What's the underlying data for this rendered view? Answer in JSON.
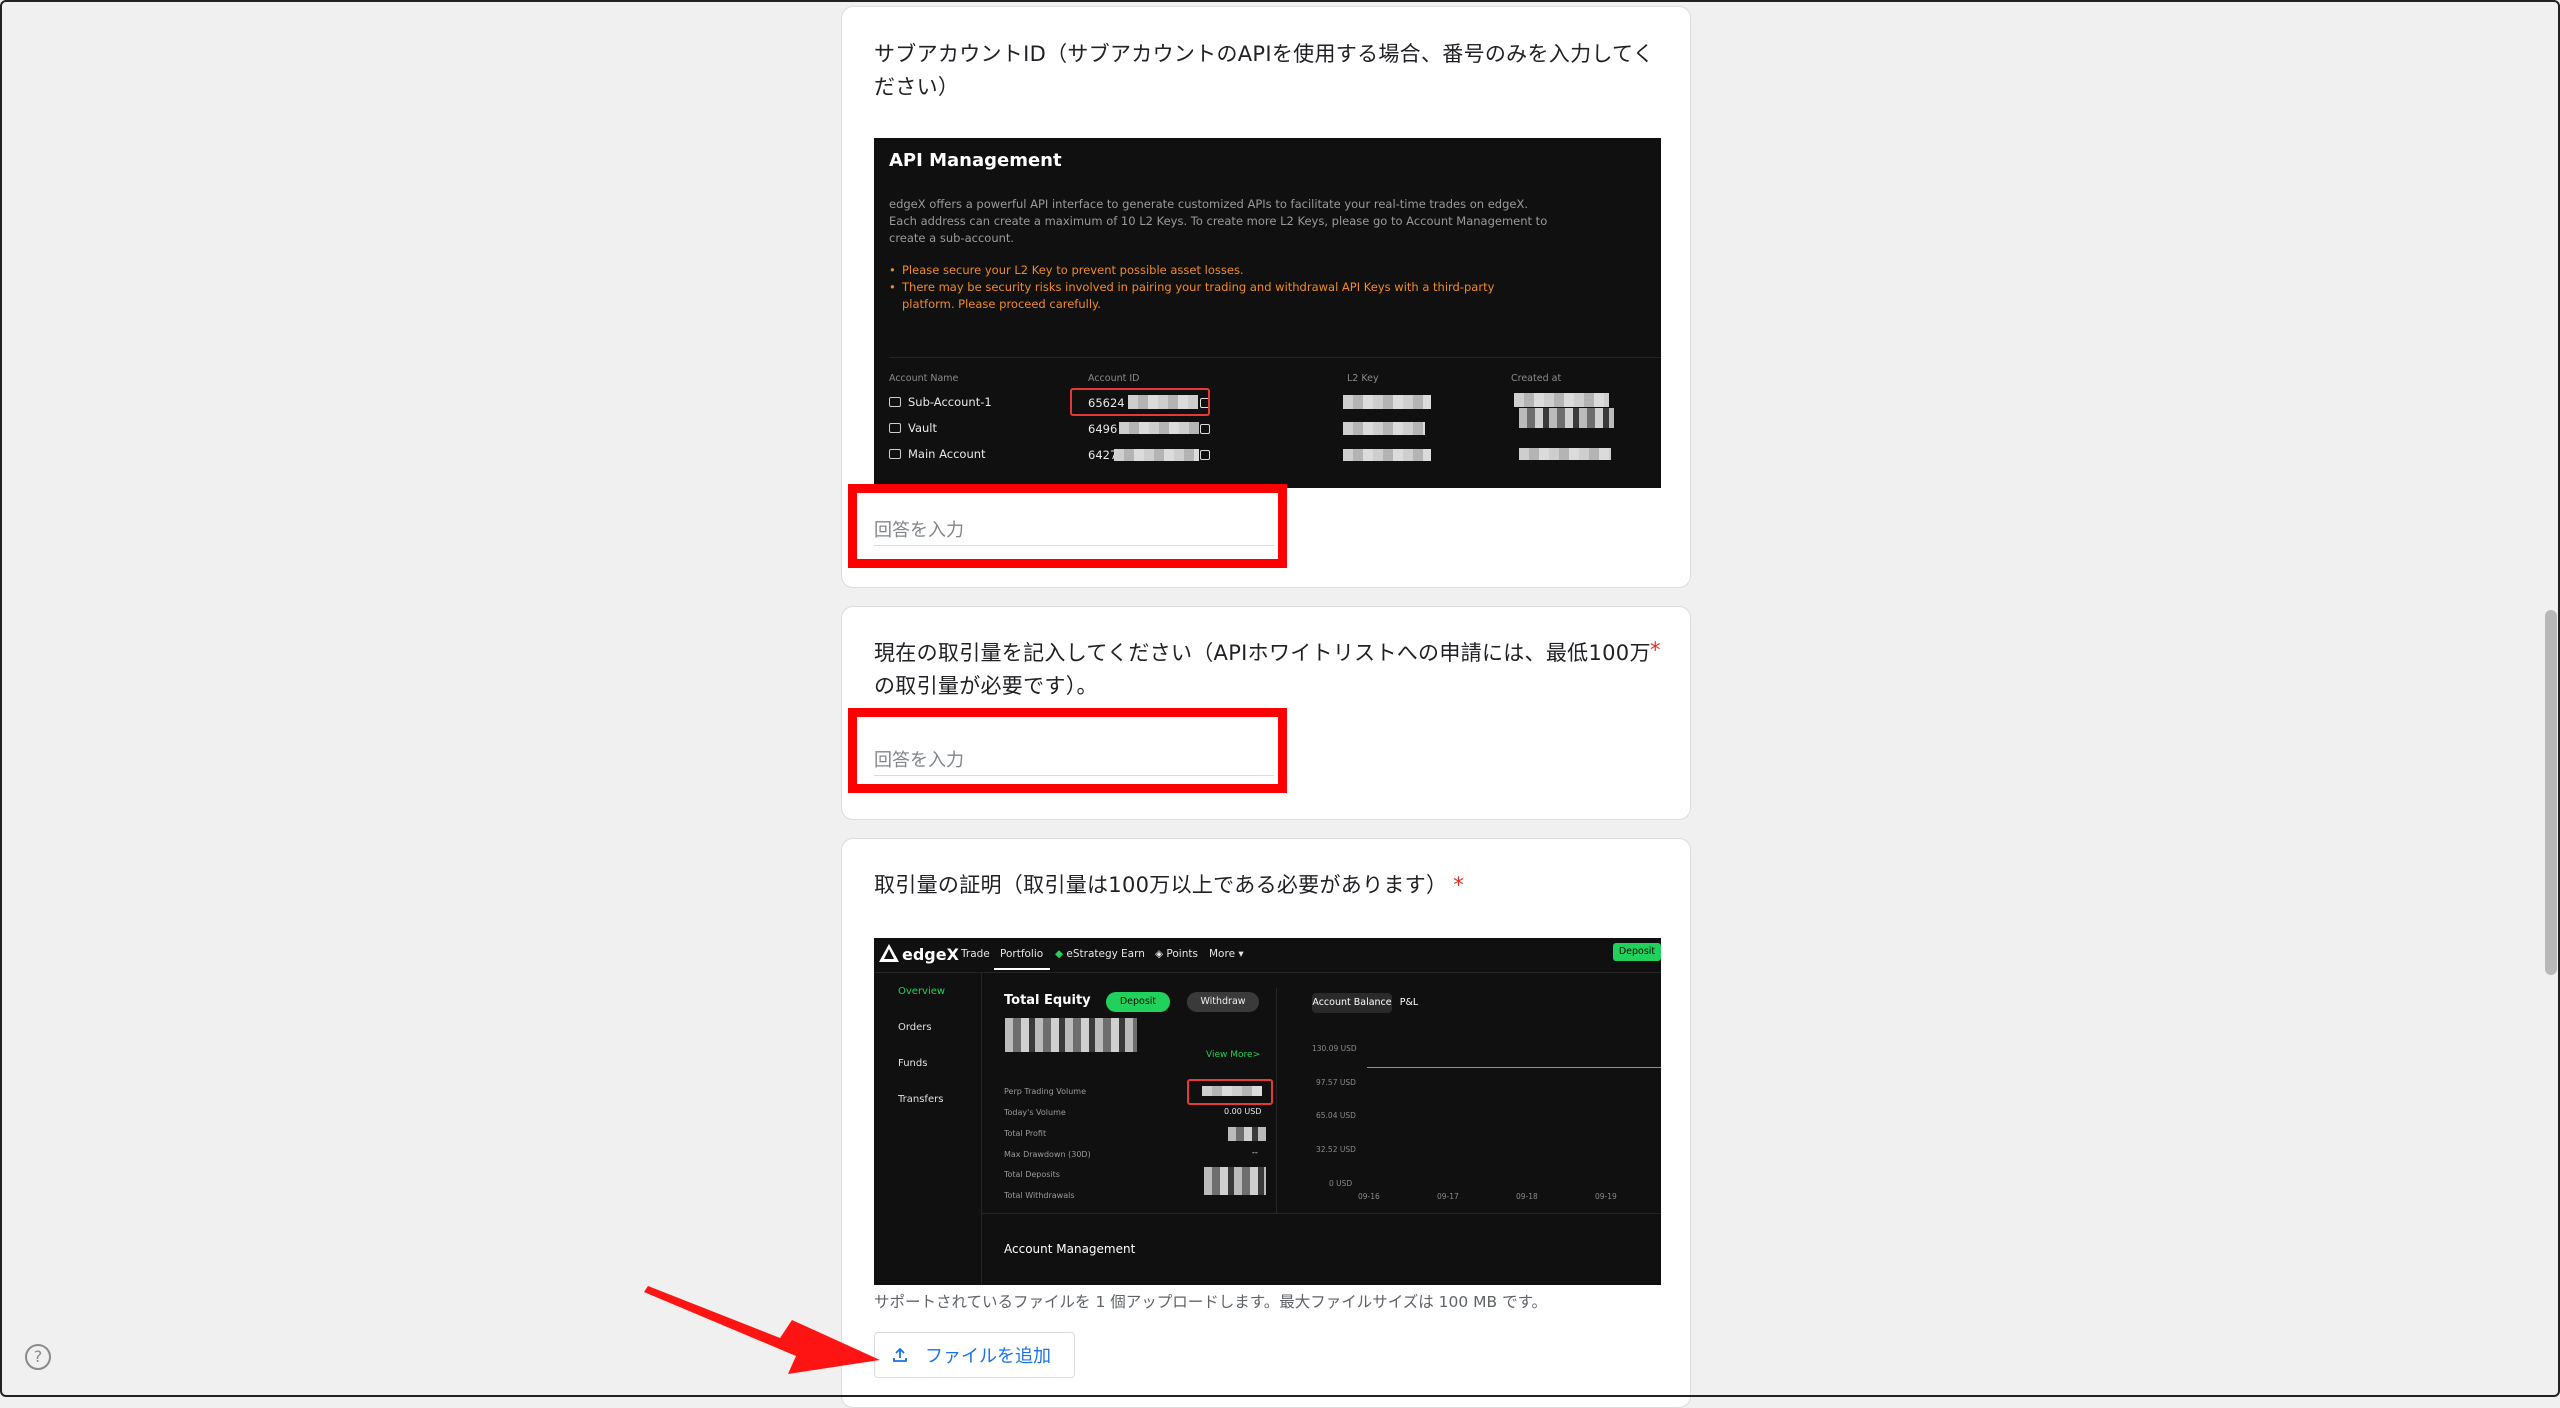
{
  "q1": {
    "title": "サブアカウントID（サブアカウントのAPIを使用する場合、番号のみを入力してください）",
    "placeholder": "回答を入力"
  },
  "api_screenshot": {
    "title": "API Management",
    "desc": "edgeX offers a powerful API interface to generate customized APIs to facilitate your real-time trades on edgeX. Each address can create a maximum of 10 L2 Keys. To create more L2 Keys, please go to Account Management to create a sub-account.",
    "warn1": "Please secure your L2 Key to prevent possible asset losses.",
    "warn2": "There may be security risks involved in pairing your trading and withdrawal API Keys with a third-party platform. Please proceed carefully.",
    "columns": [
      "Account Name",
      "Account ID",
      "L2 Key",
      "Created at"
    ],
    "rows": [
      {
        "name": "Sub-Account-1",
        "id": "65624"
      },
      {
        "name": "Vault",
        "id": "6496"
      },
      {
        "name": "Main Account",
        "id": "6427"
      }
    ]
  },
  "q2": {
    "title": "現在の取引量を記入してください（APIホワイトリストへの申請には、最低100万の取引量が必要です）。",
    "required_mark": "*",
    "placeholder": "回答を入力"
  },
  "q3": {
    "title": "取引量の証明（取引量は100万以上である必要があります）",
    "required_mark": "*",
    "file_note": "サポートされているファイルを 1 個アップロードします。最大ファイルサイズは 100 MB です。",
    "add_file_label": "ファイルを追加"
  },
  "portfolio_screenshot": {
    "logo": "edgeX",
    "nav": [
      "Trade",
      "Portfolio",
      "eStrategy",
      "Earn",
      "Points",
      "More"
    ],
    "deposit_top": "Deposit",
    "side": [
      "Overview",
      "Orders",
      "Funds",
      "Transfers"
    ],
    "total_equity": "Total Equity",
    "deposit_btn": "Deposit",
    "withdraw_btn": "Withdraw",
    "view_more": "View More>",
    "stats": [
      "Perp Trading Volume",
      "Today's Volume",
      "Total Profit",
      "Max Drawdown (30D)",
      "Total Deposits",
      "Total Withdrawals"
    ],
    "todays_volume": "0.00 USD",
    "max_drawdown": "--",
    "tabs": [
      "Account Balance",
      "P&L"
    ],
    "y_ticks": [
      "130.09 USD",
      "97.57 USD",
      "65.04 USD",
      "32.52 USD",
      "0 USD"
    ],
    "x_ticks": [
      "09-16",
      "09-17",
      "09-18",
      "09-19"
    ],
    "account_mgmt": "Account Management"
  },
  "colors": {
    "accent": "#1a73e8",
    "required": "#d93025",
    "annotation_red": "#ff0000",
    "edgex_green": "#20d15b"
  },
  "help_icon": "?"
}
